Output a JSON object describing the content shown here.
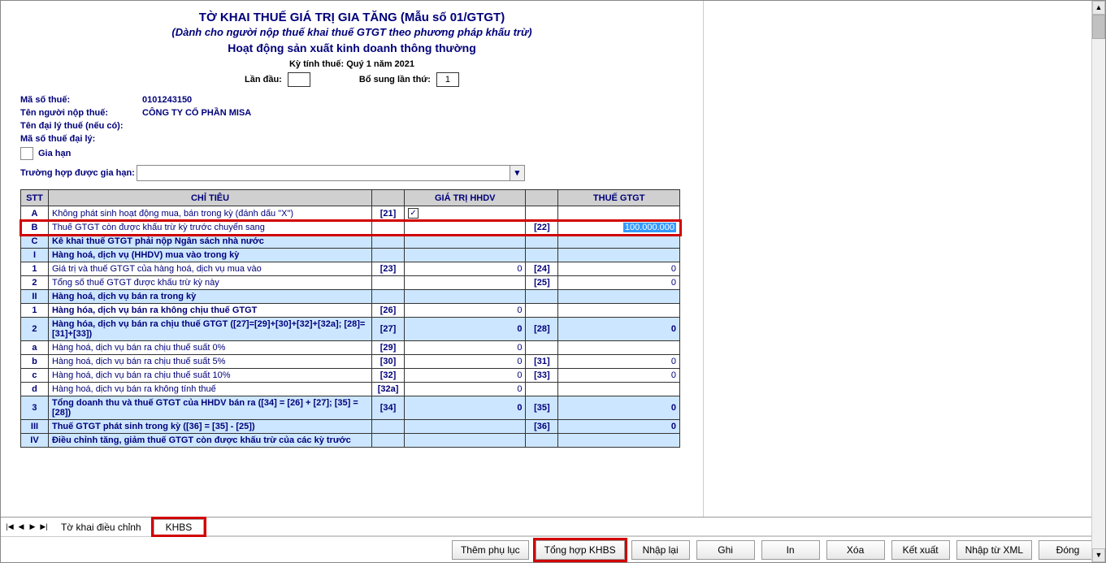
{
  "header": {
    "title_main": "TỜ KHAI THUẾ GIÁ TRỊ GIA TĂNG (Mẫu số 01/GTGT)",
    "title_sub": "(Dành cho người nộp thuế khai thuế GTGT theo phương pháp khấu trừ)",
    "activity": "Hoạt động sản xuất kinh doanh thông thường",
    "period_label": "Kỳ tính thuế: Quý 1 năm 2021",
    "first_time_label": "Lần đầu:",
    "first_time_value": "",
    "supplement_label": "Bổ sung lần thứ:",
    "supplement_value": "1"
  },
  "info": {
    "tax_code_label": "Mã số thuế:",
    "tax_code_value": "0101243150",
    "payer_label": "Tên người nộp thuế:",
    "payer_value": "CÔNG TY CỔ PHẦN MISA",
    "agent_label": "Tên đại lý thuế (nếu có):",
    "agent_value": "",
    "agent_code_label": "Mã số thuế đại lý:",
    "agent_code_value": "",
    "extension_label": "Gia hạn",
    "extension_case_label": "Trường hợp được gia hạn:"
  },
  "table": {
    "h_stt": "STT",
    "h_chitieu": "CHỈ TIÊU",
    "h_giatri": "GIÁ TRỊ HHDV",
    "h_thue": "THUẾ GTGT",
    "rows": [
      {
        "stt": "A",
        "label": "Không phát sinh hoạt động mua, bán trong kỳ (đánh dấu \"X\")",
        "code": "[21]",
        "val1_check": true
      },
      {
        "stt": "B",
        "label": "Thuế GTGT còn được khấu trừ kỳ trước chuyển sang",
        "code2": "[22]",
        "val2": "100.000.000",
        "highlight": true
      },
      {
        "stt": "C",
        "label": "Kê khai thuế GTGT phải nộp Ngân sách nhà nước",
        "section": true
      },
      {
        "stt": "I",
        "label": "Hàng hoá, dịch vụ (HHDV) mua vào trong kỳ",
        "section": true
      },
      {
        "stt": "1",
        "label": "Giá trị và thuế GTGT của hàng hoá, dịch vụ mua vào",
        "code": "[23]",
        "val1": "0",
        "code2": "[24]",
        "val2": "0"
      },
      {
        "stt": "2",
        "label": "Tổng số thuế GTGT được khấu trừ kỳ này",
        "code2": "[25]",
        "val2": "0"
      },
      {
        "stt": "II",
        "label": "Hàng hoá, dịch vụ bán ra trong kỳ",
        "section": true
      },
      {
        "stt": "1",
        "label": "Hàng hóa, dịch vụ bán ra không chịu thuế GTGT",
        "code": "[26]",
        "val1": "0",
        "bold": true
      },
      {
        "stt": "2",
        "label": "Hàng hóa, dịch vụ bán ra chịu thuế GTGT ([27]=[29]+[30]+[32]+[32a]; [28]=[31]+[33])",
        "code": "[27]",
        "val1": "0",
        "code2": "[28]",
        "val2": "0",
        "bold": true,
        "section": true
      },
      {
        "stt": "a",
        "label": "Hàng hoá, dịch vụ bán ra chịu thuế suất 0%",
        "code": "[29]",
        "val1": "0"
      },
      {
        "stt": "b",
        "label": "Hàng hoá, dịch vụ bán ra chịu thuế suất 5%",
        "code": "[30]",
        "val1": "0",
        "code2": "[31]",
        "val2": "0"
      },
      {
        "stt": "c",
        "label": "Hàng hoá, dịch vụ bán ra chịu thuế suất 10%",
        "code": "[32]",
        "val1": "0",
        "code2": "[33]",
        "val2": "0"
      },
      {
        "stt": "d",
        "label": "Hàng hoá, dịch vụ bán ra không tính thuế",
        "code": "[32a]",
        "val1": "0"
      },
      {
        "stt": "3",
        "label": "Tổng doanh thu và thuế GTGT của HHDV bán ra ([34] = [26] + [27]; [35] = [28])",
        "code": "[34]",
        "val1": "0",
        "code2": "[35]",
        "val2": "0",
        "bold": true,
        "section": true
      },
      {
        "stt": "III",
        "label": "Thuế GTGT phát sinh trong kỳ ([36] = [35] - [25])",
        "code2": "[36]",
        "val2": "0",
        "section": true
      },
      {
        "stt": "IV",
        "label": "Điều chỉnh tăng, giảm thuế GTGT còn được khấu trừ của các kỳ trước",
        "section": true
      }
    ]
  },
  "tabs": {
    "tab1": "Tờ khai điều chỉnh",
    "tab2": "KHBS"
  },
  "buttons": {
    "them_phu_luc": "Thêm phụ lục",
    "tong_hop_khbs": "Tổng hợp KHBS",
    "nhap_lai": "Nhập lại",
    "ghi": "Ghi",
    "in": "In",
    "xoa": "Xóa",
    "ket_xuat": "Kết xuất",
    "nhap_tu_xml": "Nhập từ XML",
    "dong": "Đóng"
  }
}
